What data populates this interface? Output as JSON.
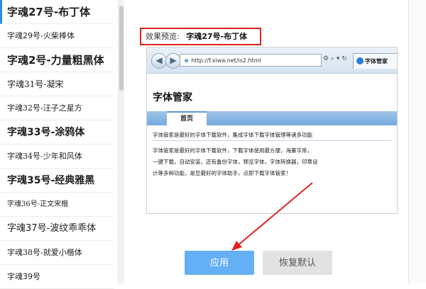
{
  "font_list": {
    "items": [
      {
        "label": "字魂27号-布丁体",
        "selected": true
      },
      {
        "label": "字魂29号-火柴棒体"
      },
      {
        "label": "字魂2号-力量粗黑体"
      },
      {
        "label": "字魂31号-凝宋"
      },
      {
        "label": "字魂32号-汪子之星方"
      },
      {
        "label": "字魂33号-涂鸦体"
      },
      {
        "label": "字魂34号-少年和风体"
      },
      {
        "label": "字魂35号-经典雅黑"
      },
      {
        "label": "字魂36号-正文宋楷"
      },
      {
        "label": "字魂37号-波纹乖乖体"
      },
      {
        "label": "字魂38号-就爱小楷体"
      },
      {
        "label": "字魂39号"
      }
    ]
  },
  "preview": {
    "label": "效果预览:",
    "font_name": "字魂27号-布丁体"
  },
  "browser": {
    "back_icon": "back-arrow-icon",
    "forward_icon": "forward-arrow-icon",
    "address": "http://f.xiwa.net/is2.html",
    "tools": "⚙ ⌕ ▾ ↻",
    "tab_label": "字体管家"
  },
  "site": {
    "title": "字体管家",
    "nav_home": "首页",
    "intro": "字体管家是最好的字体下载软件，集成字体下载字体管理等诸多功能",
    "body_lines": [
      "字体管家是最好的字体下载软件，下载字体使用最方便，海量字库，",
      "一键下载，自动安装，还有备份字体，预览字体，字体转换器，印章设",
      "计等多种功能，是您最好的字体助手，点即下载字体管家！"
    ]
  },
  "buttons": {
    "apply": "应用",
    "restore": "恢复默认"
  },
  "colors": {
    "highlight_border": "#e02121",
    "apply_bg": "#65b0f4",
    "restore_bg": "#e2e2e2",
    "arrow": "#e02121"
  }
}
